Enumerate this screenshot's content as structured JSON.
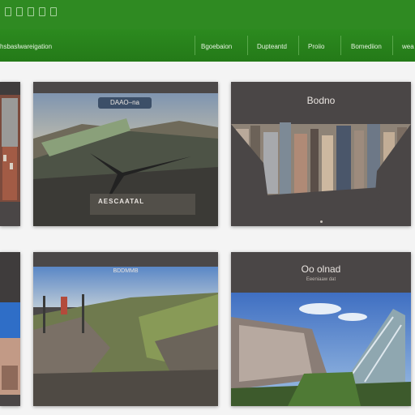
{
  "header": {
    "brand": "hsbaslwareigation",
    "nav": [
      "Bgoebaion",
      "Dupteantd",
      "Proiio",
      "Bomediion",
      "wea"
    ]
  },
  "cards": [
    {
      "caption": ""
    },
    {
      "caption": "DAAO–na",
      "overlay": "AESCAATAL"
    },
    {
      "caption": "Bodno"
    },
    {
      "caption": ""
    },
    {
      "caption": "BDDMMB"
    },
    {
      "caption": "Oo olnad",
      "subtitle": "Eeeniaaw dat"
    }
  ]
}
